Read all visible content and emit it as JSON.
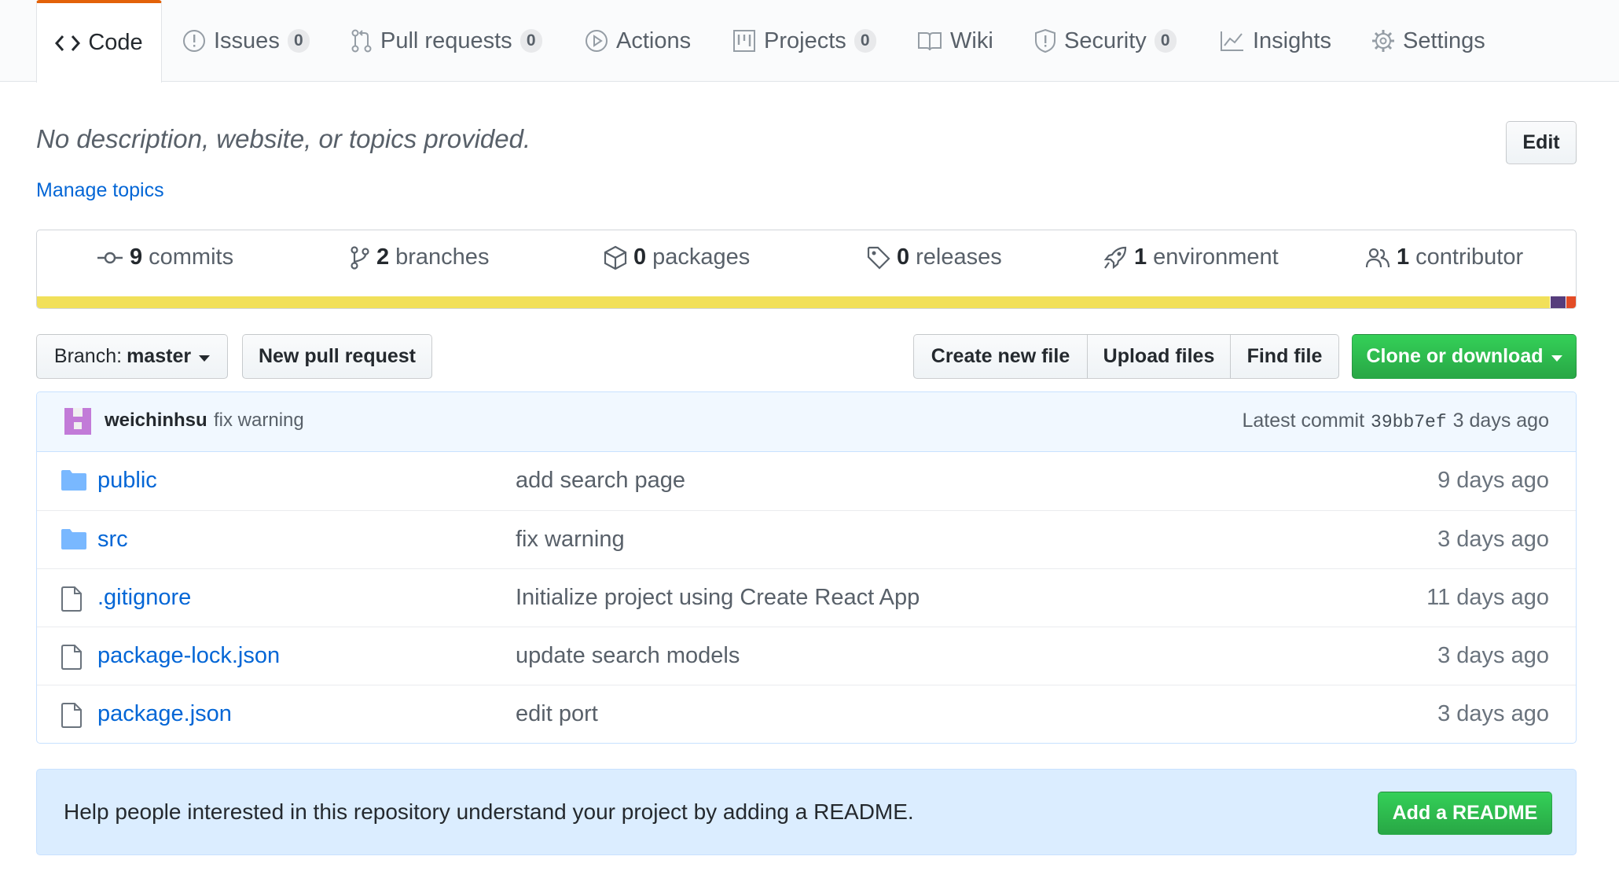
{
  "tabs": [
    {
      "label": "Code",
      "icon": "code-icon",
      "counter": null
    },
    {
      "label": "Issues",
      "icon": "issue-icon",
      "counter": "0"
    },
    {
      "label": "Pull requests",
      "icon": "pull-request-icon",
      "counter": "0"
    },
    {
      "label": "Actions",
      "icon": "play-icon",
      "counter": null
    },
    {
      "label": "Projects",
      "icon": "project-icon",
      "counter": "0"
    },
    {
      "label": "Wiki",
      "icon": "book-icon",
      "counter": null
    },
    {
      "label": "Security",
      "icon": "shield-icon",
      "counter": "0"
    },
    {
      "label": "Insights",
      "icon": "graph-icon",
      "counter": null
    },
    {
      "label": "Settings",
      "icon": "gear-icon",
      "counter": null
    }
  ],
  "about": {
    "description": "No description, website, or topics provided.",
    "manage_topics": "Manage topics",
    "edit_label": "Edit"
  },
  "summary": {
    "commits": {
      "count": "9",
      "label": "commits"
    },
    "branches": {
      "count": "2",
      "label": "branches"
    },
    "packages": {
      "count": "0",
      "label": "packages"
    },
    "releases": {
      "count": "0",
      "label": "releases"
    },
    "environments": {
      "count": "1",
      "label": "environment"
    },
    "contributors": {
      "count": "1",
      "label": "contributor"
    },
    "languages": [
      {
        "color": "#f1e05a",
        "share": 0.9839
      },
      {
        "color": "#563d7c",
        "share": 0.0102
      },
      {
        "color": "#e34c26",
        "share": 0.0059
      }
    ]
  },
  "nav": {
    "branch_prefix": "Branch:",
    "branch_name": "master",
    "new_pr_label": "New pull request",
    "create_file_label": "Create new file",
    "upload_label": "Upload files",
    "find_label": "Find file",
    "clone_label": "Clone or download"
  },
  "commit": {
    "author": "weichinhsu",
    "message": "fix warning",
    "latest_label": "Latest commit",
    "sha": "39bb7ef",
    "age": "3 days ago"
  },
  "files": [
    {
      "type": "dir",
      "name": "public",
      "message": "add search page",
      "age": "9 days ago"
    },
    {
      "type": "dir",
      "name": "src",
      "message": "fix warning",
      "age": "3 days ago"
    },
    {
      "type": "file",
      "name": ".gitignore",
      "message": "Initialize project using Create React App",
      "age": "11 days ago"
    },
    {
      "type": "file",
      "name": "package-lock.json",
      "message": "update search models",
      "age": "3 days ago"
    },
    {
      "type": "file",
      "name": "package.json",
      "message": "edit port",
      "age": "3 days ago"
    }
  ],
  "readme": {
    "text": "Help people interested in this repository understand your project by adding a README.",
    "button_label": "Add a README"
  }
}
